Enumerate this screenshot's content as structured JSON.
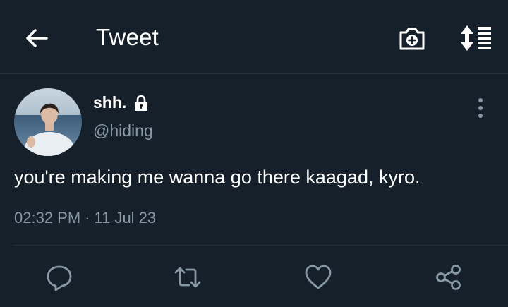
{
  "header": {
    "title": "Tweet",
    "back_icon": "arrow-left-icon",
    "camera_icon": "camera-plus-icon",
    "sort_icon": "sort-list-icon"
  },
  "tweet": {
    "display_name": "shh.",
    "handle": "@hiding",
    "protected_icon": "lock-icon",
    "text": "you're making me wanna go there kaagad, kyro.",
    "time": "02:32 PM",
    "separator": "·",
    "date": "11 Jul 23"
  },
  "actions": {
    "reply_icon": "reply-icon",
    "retweet_icon": "retweet-icon",
    "like_icon": "heart-icon",
    "share_icon": "share-icon"
  },
  "colors": {
    "background": "#15202b",
    "text": "#ffffff",
    "secondary": "#8899a6",
    "divider": "#253341"
  }
}
